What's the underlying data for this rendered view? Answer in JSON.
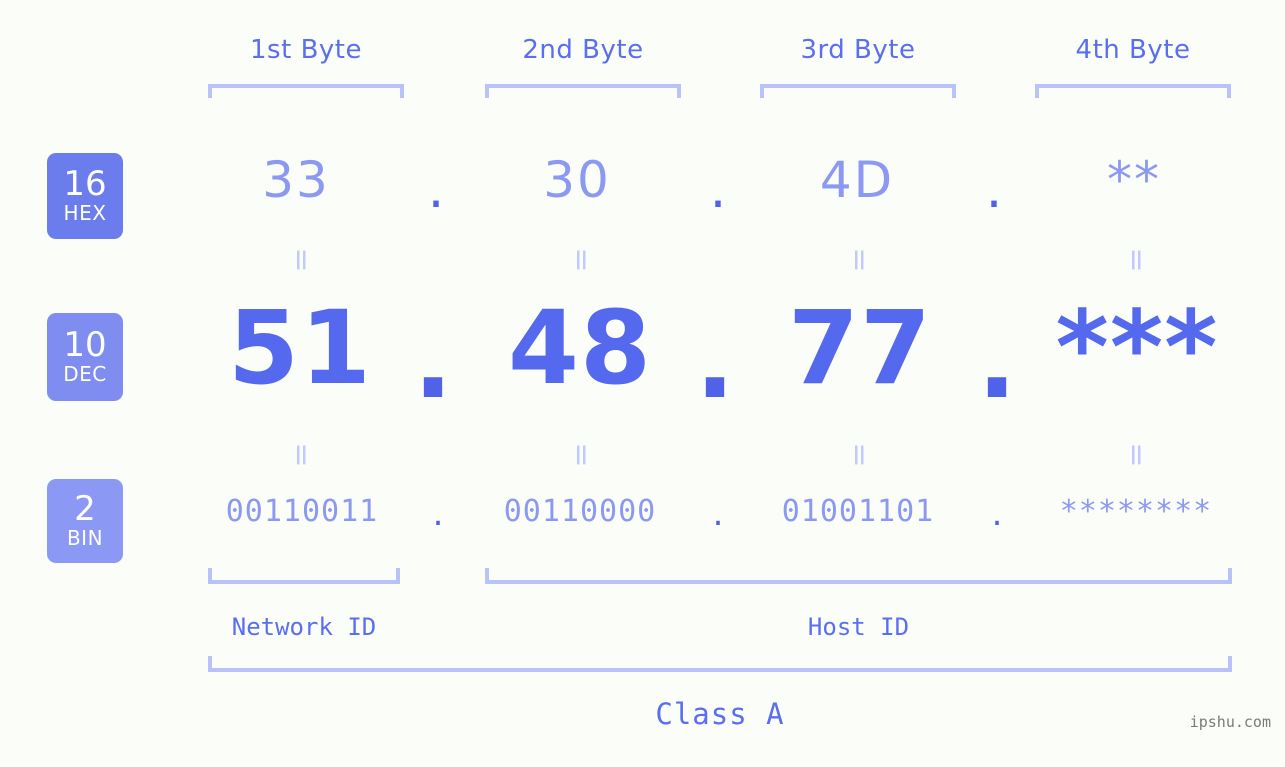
{
  "watermark": "ipshu.com",
  "colors": {
    "background": "#fbfdf8",
    "accent_strong": "#4f62e8",
    "accent": "#5a6ef0",
    "accent_light": "#8c99f2",
    "bracket": "#b9c2fb",
    "badge_hex": "#6b7ced",
    "badge_dec": "#7f8df0",
    "badge_bin": "#8b99f4",
    "watermark_text": "#7a7a7a"
  },
  "byte_headers": [
    {
      "label": "1st Byte"
    },
    {
      "label": "2nd Byte"
    },
    {
      "label": "3rd Byte"
    },
    {
      "label": "4th Byte"
    }
  ],
  "radix_badges": [
    {
      "number": "16",
      "name": "HEX"
    },
    {
      "number": "10",
      "name": "DEC"
    },
    {
      "number": "2",
      "name": "BIN"
    }
  ],
  "rows": {
    "hex": {
      "radix": "16",
      "radix_name": "HEX",
      "values": [
        "33",
        "30",
        "4D",
        "**"
      ],
      "separator": "."
    },
    "dec": {
      "radix": "10",
      "radix_name": "DEC",
      "values": [
        "51",
        "48",
        "77",
        "***"
      ],
      "separator": "."
    },
    "bin": {
      "radix": "2",
      "radix_name": "BIN",
      "values": [
        "00110011",
        "00110000",
        "01001101",
        "********"
      ],
      "separator": "."
    }
  },
  "equals_marks": [
    "=",
    "=",
    "=",
    "=",
    "=",
    "=",
    "=",
    "="
  ],
  "sections": {
    "network_id": "Network ID",
    "host_id": "Host ID",
    "class": "Class A"
  }
}
